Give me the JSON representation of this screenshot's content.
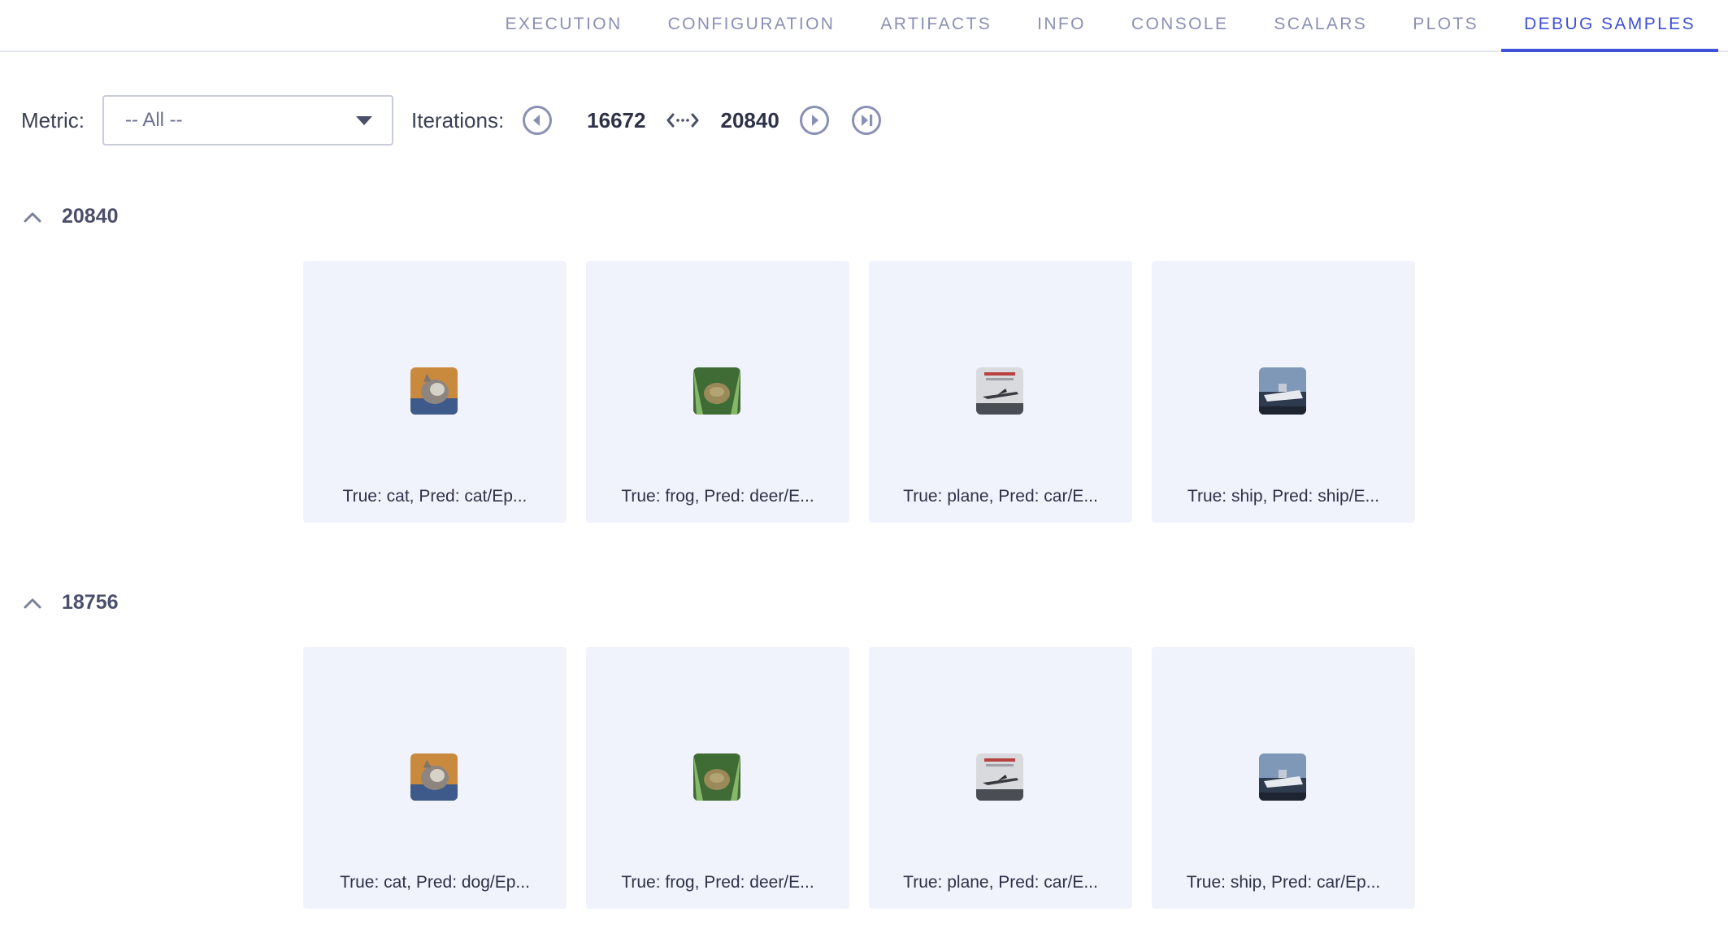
{
  "tabs": [
    {
      "label": "EXECUTION",
      "active": false
    },
    {
      "label": "CONFIGURATION",
      "active": false
    },
    {
      "label": "ARTIFACTS",
      "active": false
    },
    {
      "label": "INFO",
      "active": false
    },
    {
      "label": "CONSOLE",
      "active": false
    },
    {
      "label": "SCALARS",
      "active": false
    },
    {
      "label": "PLOTS",
      "active": false
    },
    {
      "label": "DEBUG SAMPLES",
      "active": true
    }
  ],
  "toolbar": {
    "metric_label": "Metric:",
    "metric_value": "-- All --",
    "iterations_label": "Iterations:",
    "iteration_from": "16672",
    "iteration_to": "20840"
  },
  "sections": [
    {
      "iteration": "20840",
      "samples": [
        {
          "caption": "True: cat, Pred: cat/Ep...",
          "thumb": "cat"
        },
        {
          "caption": "True: frog, Pred: deer/E...",
          "thumb": "frog"
        },
        {
          "caption": "True: plane, Pred: car/E...",
          "thumb": "plane"
        },
        {
          "caption": "True: ship, Pred: ship/E...",
          "thumb": "ship"
        }
      ]
    },
    {
      "iteration": "18756",
      "samples": [
        {
          "caption": "True: cat, Pred: dog/Ep...",
          "thumb": "cat"
        },
        {
          "caption": "True: frog, Pred: deer/E...",
          "thumb": "frog"
        },
        {
          "caption": "True: plane, Pred: car/E...",
          "thumb": "plane"
        },
        {
          "caption": "True: ship, Pred: car/Ep...",
          "thumb": "ship"
        }
      ]
    }
  ],
  "colors": {
    "accent": "#3f51d6",
    "tab_inactive": "#8a90b4",
    "card_bg": "#f0f3fb",
    "icon": "#8a90b4"
  },
  "icons": {
    "prev": "chevron-left-circle-icon",
    "next": "chevron-right-circle-icon",
    "last": "skip-to-end-circle-icon",
    "range": "range-arrows-icon",
    "collapse": "chevron-up-icon",
    "dropdown": "caret-down-icon"
  }
}
